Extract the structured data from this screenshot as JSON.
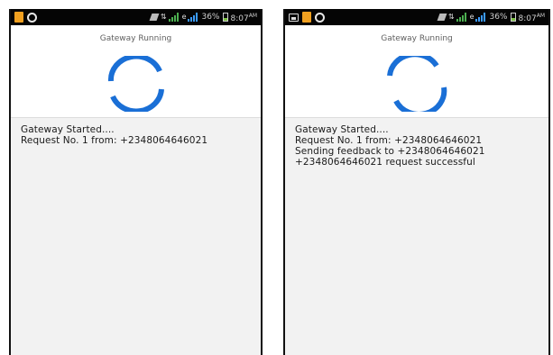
{
  "screens": [
    {
      "status": {
        "battery": "36%",
        "time": "8:07",
        "ampm": "AM"
      },
      "title": "Gateway Running",
      "log": [
        "Gateway Started....",
        "Request No. 1 from: +2348064646021"
      ]
    },
    {
      "status": {
        "battery": "36%",
        "time": "8:07",
        "ampm": "AM"
      },
      "title": "Gateway Running",
      "log": [
        "Gateway Started....",
        "Request No. 1 from: +2348064646021",
        "Sending feedback to +2348064646021",
        "+2348064646021 request successful"
      ]
    }
  ],
  "colors": {
    "spinner": "#1a6fd6",
    "status_bar": "#050505",
    "log_background": "#f2f2f2"
  },
  "icons": [
    "gallery-icon",
    "sim-icon",
    "whatsapp-icon",
    "silent-icon",
    "network-icon",
    "signal-icon",
    "battery-icon"
  ]
}
